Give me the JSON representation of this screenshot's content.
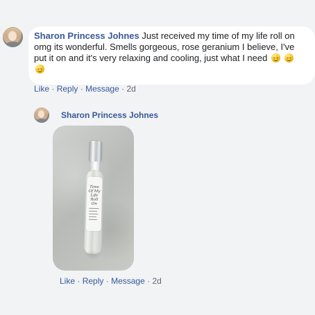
{
  "comment": {
    "author": "Sharon Princess Johnes",
    "text": "Just received my time of my life roll on omg its wonderful. Smells gorgeous, rose geranium I believe, I've put it on and it's very relaxing and cooling, just what I need",
    "actions": {
      "like": "Like",
      "reply": "Reply",
      "message": "Message",
      "time": "2d"
    }
  },
  "reply": {
    "author": "Sharon Princess Johnes",
    "actions": {
      "like": "Like",
      "reply": "Reply",
      "message": "Message",
      "time": "2d"
    },
    "photo": {
      "label_text": "Time Of My Life Roll On"
    }
  }
}
